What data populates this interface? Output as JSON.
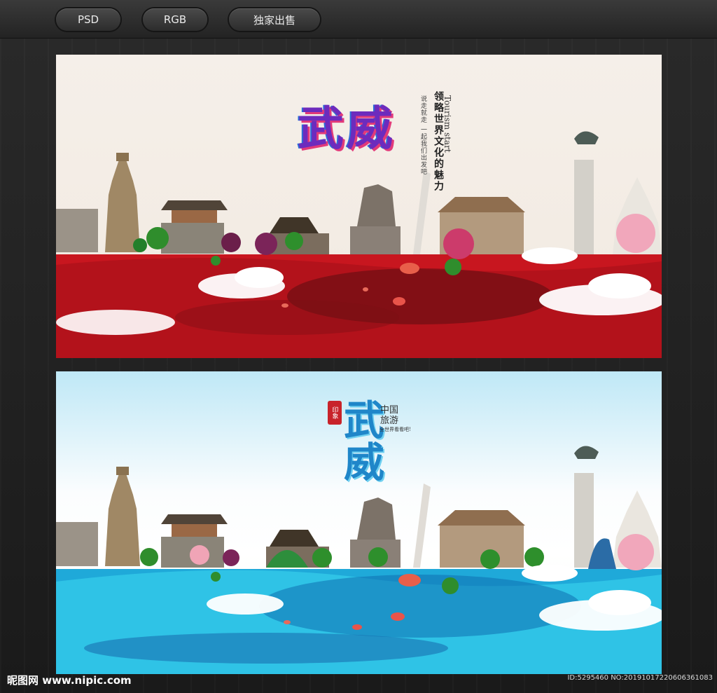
{
  "toolbar": {
    "psd_label": "PSD",
    "rgb_label": "RGB",
    "exclusive_label": "独家出售"
  },
  "poster_top": {
    "title": "武威",
    "slogan": "领略世界文化的魅力",
    "subtitle_en": "Tourism start",
    "side_small": "说走就走 一起我们出发吧"
  },
  "poster_bottom": {
    "title_line1": "武",
    "title_line2": "威",
    "seal": "印象",
    "china_line1": "中国",
    "china_line2": "旅游",
    "tag": "全世界看看吧!"
  },
  "watermark": {
    "left": "昵图网 www.nipic.com",
    "right": "ID:5295460 NO:20191017220606361083"
  },
  "colors": {
    "top_ground": "#c8161f",
    "bottom_water": "#1fa9d9",
    "title_top": "#6d2bbd",
    "title_bottom": "#1f86c9"
  }
}
